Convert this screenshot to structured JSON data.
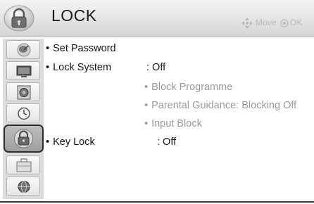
{
  "header": {
    "title": "LOCK",
    "icon": "lock-icon",
    "hints": [
      {
        "icon": "dpad-icon",
        "label": "Move"
      },
      {
        "icon": "ok-button-icon",
        "label": "OK"
      }
    ]
  },
  "sidebar": {
    "items": [
      {
        "name": "setup",
        "icon": "satellite-dish-icon",
        "selected": false
      },
      {
        "name": "picture",
        "icon": "tv-screen-icon",
        "selected": false
      },
      {
        "name": "audio",
        "icon": "speaker-icon",
        "selected": false
      },
      {
        "name": "time",
        "icon": "clock-icon",
        "selected": false
      },
      {
        "name": "lock",
        "icon": "lock-icon",
        "selected": true
      },
      {
        "name": "option",
        "icon": "briefcase-icon",
        "selected": false
      },
      {
        "name": "network",
        "icon": "globe-icon",
        "selected": false
      }
    ]
  },
  "menu": {
    "bullet": "•",
    "set_password": "Set Password",
    "lock_system": {
      "label": "Lock System",
      "value": ": Off"
    },
    "sub_items": [
      "Block Programme",
      "Parental Guidance: Blocking Off",
      "Input Block"
    ],
    "key_lock": {
      "label": "Key Lock",
      "value": ": Off"
    }
  },
  "colors": {
    "header_bg": "#e3e3e3",
    "sidebar_bg": "#dcdcdc",
    "disabled_text": "#9a9a9a",
    "text": "#151515"
  }
}
